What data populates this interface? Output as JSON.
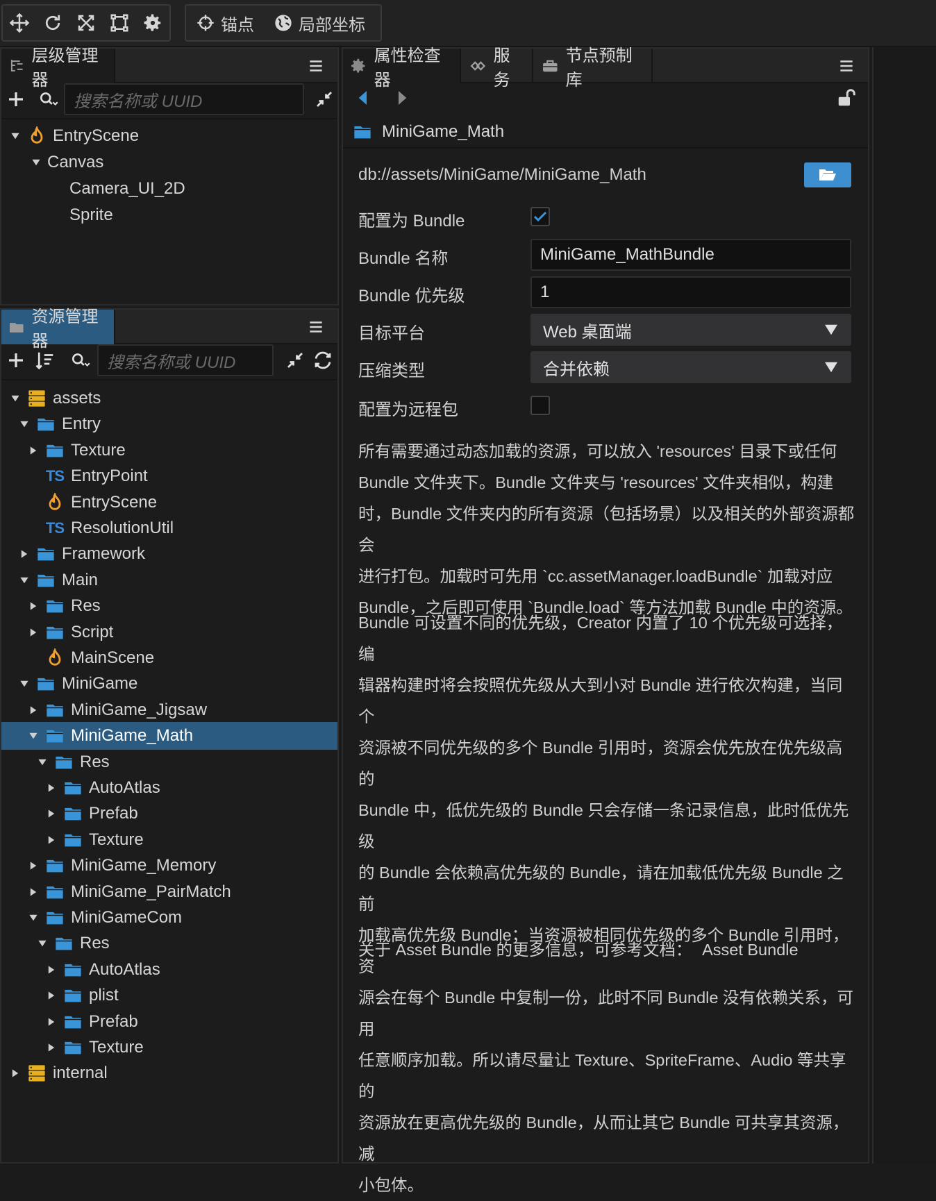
{
  "toolbar": {
    "tools": [
      "move-tool",
      "rotate-tool",
      "scale-tool",
      "rect-tool",
      "transform-tool"
    ],
    "anchor_label": "锚点",
    "coord_label": "局部坐标"
  },
  "hierarchy": {
    "tab_label": "层级管理器",
    "search_placeholder": "搜索名称或 UUID",
    "items": [
      {
        "label": "EntryScene",
        "icon": "scene-icon"
      },
      {
        "label": "Canvas"
      },
      {
        "label": "Camera_UI_2D"
      },
      {
        "label": "Sprite"
      }
    ]
  },
  "assets": {
    "tab_label": "资源管理器",
    "search_placeholder": "搜索名称或 UUID",
    "items": [
      {
        "label": "assets",
        "icon": "database-icon"
      },
      {
        "label": "Entry",
        "icon": "folder-icon"
      },
      {
        "label": "Texture",
        "icon": "folder-icon"
      },
      {
        "label": "EntryPoint",
        "icon": "typescript-icon"
      },
      {
        "label": "EntryScene",
        "icon": "scene-icon"
      },
      {
        "label": "ResolutionUtil",
        "icon": "typescript-icon"
      },
      {
        "label": "Framework",
        "icon": "folder-icon"
      },
      {
        "label": "Main",
        "icon": "folder-icon"
      },
      {
        "label": "Res",
        "icon": "folder-icon"
      },
      {
        "label": "Script",
        "icon": "folder-icon"
      },
      {
        "label": "MainScene",
        "icon": "scene-icon"
      },
      {
        "label": "MiniGame",
        "icon": "folder-icon"
      },
      {
        "label": "MiniGame_Jigsaw",
        "icon": "folder-icon"
      },
      {
        "label": "MiniGame_Math",
        "icon": "folder-icon"
      },
      {
        "label": "Res",
        "icon": "folder-icon"
      },
      {
        "label": "AutoAtlas",
        "icon": "folder-icon"
      },
      {
        "label": "Prefab",
        "icon": "folder-icon"
      },
      {
        "label": "Texture",
        "icon": "folder-icon"
      },
      {
        "label": "MiniGame_Memory",
        "icon": "folder-icon"
      },
      {
        "label": "MiniGame_PairMatch",
        "icon": "folder-icon"
      },
      {
        "label": "MiniGameCom",
        "icon": "folder-icon"
      },
      {
        "label": "Res",
        "icon": "folder-icon"
      },
      {
        "label": "AutoAtlas",
        "icon": "folder-icon"
      },
      {
        "label": "plist",
        "icon": "folder-icon"
      },
      {
        "label": "Prefab",
        "icon": "folder-icon"
      },
      {
        "label": "Texture",
        "icon": "folder-icon"
      },
      {
        "label": "internal",
        "icon": "database-icon"
      }
    ]
  },
  "inspector": {
    "tabs": [
      "属性检查器",
      "服务",
      "节点预制库"
    ],
    "asset_name": "MiniGame_Math",
    "asset_path": "db://assets/MiniGame/MiniGame_Math",
    "fields": {
      "is_bundle_label": "配置为 Bundle",
      "is_bundle_checked": true,
      "bundle_name_label": "Bundle 名称",
      "bundle_name_value": "MiniGame_MathBundle",
      "priority_label": "Bundle 优先级",
      "priority_value": "1",
      "platform_label": "目标平台",
      "platform_value": "Web 桌面端",
      "compression_label": "压缩类型",
      "compression_value": "合并依赖",
      "remote_label": "配置为远程包",
      "remote_checked": false
    },
    "para1": [
      "所有需要通过动态加载的资源，可以放入 'resources' 目录下或任何",
      "Bundle 文件夹下。Bundle 文件夹与 'resources' 文件夹相似，构建",
      "时，Bundle 文件夹内的所有资源（包括场景）以及相关的外部资源都会",
      "进行打包。加载时可先用 `cc.assetManager.loadBundle` 加载对应",
      "Bundle，之后即可使用 `Bundle.load` 等方法加载 Bundle 中的资源。"
    ],
    "para2": [
      "Bundle 可设置不同的优先级，Creator 内置了 10 个优先级可选择，编",
      "辑器构建时将会按照优先级从大到小对 Bundle 进行依次构建，当同个",
      "资源被不同优先级的多个 Bundle 引用时，资源会优先放在优先级高的",
      "Bundle 中，低优先级的 Bundle 只会存储一条记录信息，此时低优先级",
      "的 Bundle 会依赖高优先级的 Bundle，请在加载低优先级 Bundle 之前",
      "加载高优先级 Bundle；当资源被相同优先级的多个 Bundle 引用时，资",
      "源会在每个 Bundle 中复制一份，此时不同 Bundle 没有依赖关系，可用",
      "任意顺序加载。所以请尽量让 Texture、SpriteFrame、Audio 等共享的",
      "资源放在更高优先级的 Bundle，从而让其它 Bundle 可共享其资源，减",
      "小包体。"
    ],
    "doc_text": "关于 Asset Bundle 的更多信息，可参考文档：",
    "doc_link": "Asset Bundle"
  },
  "colors": {
    "selection": "#2b5b80",
    "folder": "#3a95d8",
    "scene": "#f0a030",
    "database": "#e8b020",
    "accent_button": "#3e8fcf"
  }
}
